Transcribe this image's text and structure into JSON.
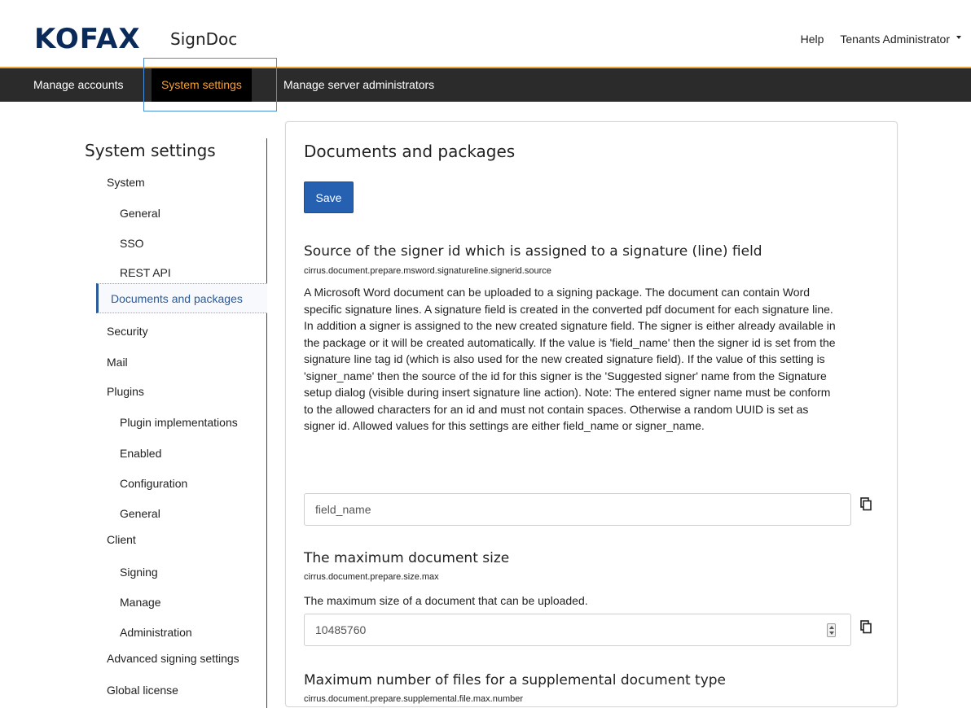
{
  "header": {
    "brand": "KOFAX",
    "product": "SignDoc",
    "help_label": "Help",
    "user_menu_label": "Tenants Administrator"
  },
  "nav": {
    "items": [
      {
        "label": "Manage accounts"
      },
      {
        "label": "System settings"
      },
      {
        "label": "Manage server administrators"
      }
    ]
  },
  "sidebar": {
    "title": "System settings",
    "items": [
      {
        "label": "System"
      },
      {
        "label": "General"
      },
      {
        "label": "SSO"
      },
      {
        "label": "REST API"
      },
      {
        "label": "Documents and packages"
      },
      {
        "label": "Security"
      },
      {
        "label": "Mail"
      },
      {
        "label": "Plugins"
      },
      {
        "label": "Plugin implementations"
      },
      {
        "label": "Enabled"
      },
      {
        "label": "Configuration"
      },
      {
        "label": "General"
      },
      {
        "label": "Client"
      },
      {
        "label": "Signing"
      },
      {
        "label": "Manage"
      },
      {
        "label": "Administration"
      },
      {
        "label": "Advanced signing settings"
      },
      {
        "label": "Global license"
      }
    ]
  },
  "main": {
    "title": "Documents and packages",
    "save_label": "Save",
    "settings": [
      {
        "title": "Source of the signer id which is assigned to a signature (line) field",
        "key": "cirrus.document.prepare.msword.signatureline.signerid.source",
        "description": "A Microsoft Word document can be uploaded to a signing package. The document can contain Word specific signature lines. A signature field is created in the converted pdf document for each signature line. In addition a signer is assigned to the new created signature field. The signer is either already available in the package or it will be created automatically. If the value is 'field_name' then the signer id is set from the signature line tag id (which is also used for the new created signature field). If the value of this setting is 'signer_name' then the source of the id for this signer is the 'Suggested signer' name from the Signature setup dialog (visible during insert signature line action). Note: The entered signer name must be conform to the allowed characters for an id and must not contain spaces. Otherwise a random UUID is set as signer id. Allowed values for this settings are either field_name or signer_name.",
        "value": "field_name"
      },
      {
        "title": "The maximum document size",
        "key": "cirrus.document.prepare.size.max",
        "description": "The maximum size of a document that can be uploaded.",
        "value": "10485760"
      },
      {
        "title": "Maximum number of files for a supplemental document type",
        "key": "cirrus.document.prepare.supplemental.file.max.number"
      }
    ]
  },
  "colors": {
    "nav_bg": "#2b2b2b",
    "nav_active_text": "#f3a03a",
    "accent_line": "#e8a33d",
    "primary_button": "#2660b0",
    "brand": "#0a2b5a",
    "sidebar_active": "#2a5a9a"
  }
}
